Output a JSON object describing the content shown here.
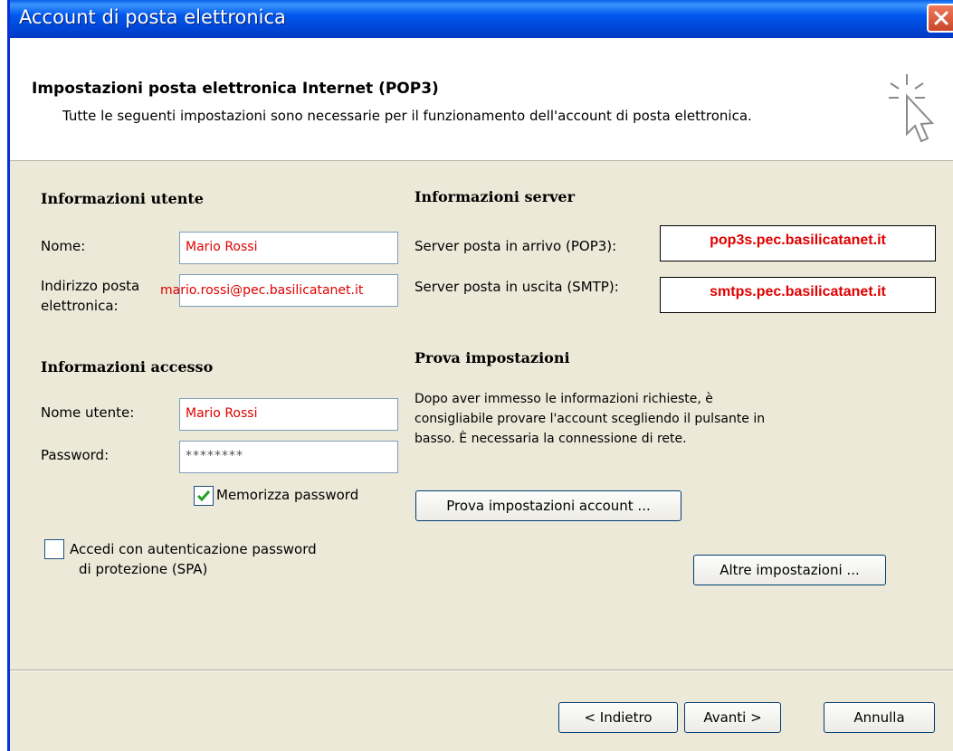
{
  "window": {
    "title": "Account di posta elettronica"
  },
  "header": {
    "title": "Impostazioni posta elettronica Internet (POP3)",
    "description": "Tutte le seguenti impostazioni sono necessarie per il funzionamento dell'account di posta elettronica."
  },
  "user_info": {
    "heading": "Informazioni utente",
    "name_label": "Nome:",
    "name_value": "Mario Rossi",
    "email_label_line1": "Indirizzo posta",
    "email_label_line2": "elettronica:",
    "email_value": "mario.rossi@pec.basilicatanet.it"
  },
  "server_info": {
    "heading": "Informazioni server",
    "incoming_label": "Server posta in arrivo (POP3):",
    "incoming_value": "pop3s.pec.basilicatanet.it",
    "outgoing_label": "Server posta in uscita (SMTP):",
    "outgoing_value": "smtps.pec.basilicatanet.it"
  },
  "access_info": {
    "heading": "Informazioni accesso",
    "username_label": "Nome utente:",
    "username_value": "Mario Rossi",
    "password_label": "Password:",
    "password_value": "********",
    "remember_password_label": "Memorizza password",
    "remember_password_checked": true,
    "spa_label_line1": "Accedi con autenticazione password",
    "spa_label_line2": "di protezione (SPA)",
    "spa_checked": false
  },
  "test_settings": {
    "heading": "Prova impostazioni",
    "description": "Dopo aver immesso le informazioni richieste, è consigliabile provare l'account scegliendo il pulsante in basso. È necessaria la connessione di rete.",
    "test_button": "Prova impostazioni account ...",
    "more_settings_button": "Altre impostazioni ..."
  },
  "footer": {
    "back_button": "< Indietro",
    "next_button": "Avanti >",
    "cancel_button": "Annulla"
  },
  "colors": {
    "titlebar": "#0058ee",
    "dialog_bg": "#ece9d8",
    "value_text": "#e00000"
  },
  "icons": {
    "close": "close-icon",
    "wizard": "cursor-sparkle-icon",
    "check": "check-icon"
  }
}
